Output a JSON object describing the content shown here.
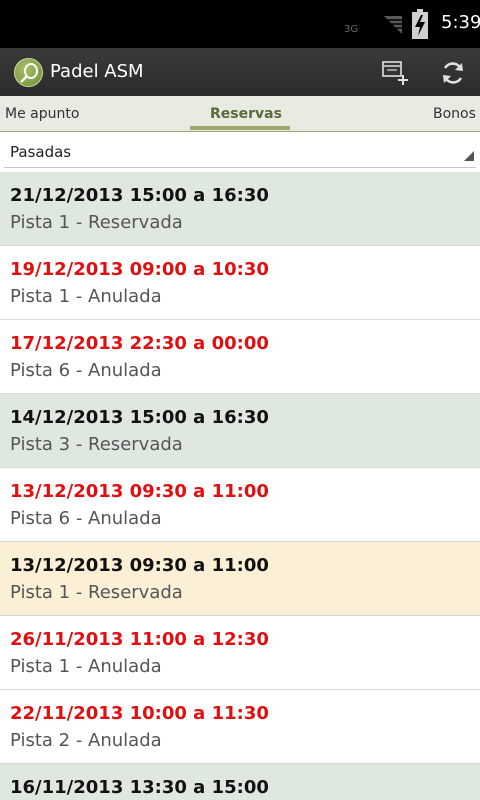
{
  "status_bar": {
    "network": "3G",
    "time": "5:39"
  },
  "app": {
    "title": "Padel ASM"
  },
  "tabs": [
    {
      "label": "Me apunto",
      "active": false
    },
    {
      "label": "Reservas",
      "active": true
    },
    {
      "label": "Bonos",
      "active": false
    }
  ],
  "filter": {
    "selected": "Pasadas"
  },
  "colors": {
    "reserved_bg": "#dfe8df",
    "highlight_bg": "#fbefd6",
    "cancelled_text": "#e01010",
    "normal_text": "#111111",
    "default_bg": "#ffffff"
  },
  "reservations": [
    {
      "datetime": "21/12/2013 15:00 a 16:30",
      "detail": "Pista 1 - Reservada",
      "status": "reservada",
      "bg": "#dfe8df"
    },
    {
      "datetime": "19/12/2013 09:00 a 10:30",
      "detail": "Pista 1 - Anulada",
      "status": "anulada",
      "bg": "#ffffff"
    },
    {
      "datetime": "17/12/2013 22:30 a 00:00",
      "detail": "Pista 6 - Anulada",
      "status": "anulada",
      "bg": "#ffffff"
    },
    {
      "datetime": "14/12/2013 15:00 a 16:30",
      "detail": "Pista 3 - Reservada",
      "status": "reservada",
      "bg": "#dfe8df"
    },
    {
      "datetime": "13/12/2013 09:30 a 11:00",
      "detail": "Pista 6 - Anulada",
      "status": "anulada",
      "bg": "#ffffff"
    },
    {
      "datetime": "13/12/2013 09:30 a 11:00",
      "detail": "Pista 1 - Reservada",
      "status": "reservada",
      "bg": "#fbefd6"
    },
    {
      "datetime": "26/11/2013 11:00 a 12:30",
      "detail": "Pista 1 - Anulada",
      "status": "anulada",
      "bg": "#ffffff"
    },
    {
      "datetime": "22/11/2013 10:00 a 11:30",
      "detail": "Pista 2 - Anulada",
      "status": "anulada",
      "bg": "#ffffff"
    },
    {
      "datetime": "16/11/2013 13:30 a 15:00",
      "detail": "",
      "status": "reservada",
      "bg": "#dfe8df"
    }
  ]
}
